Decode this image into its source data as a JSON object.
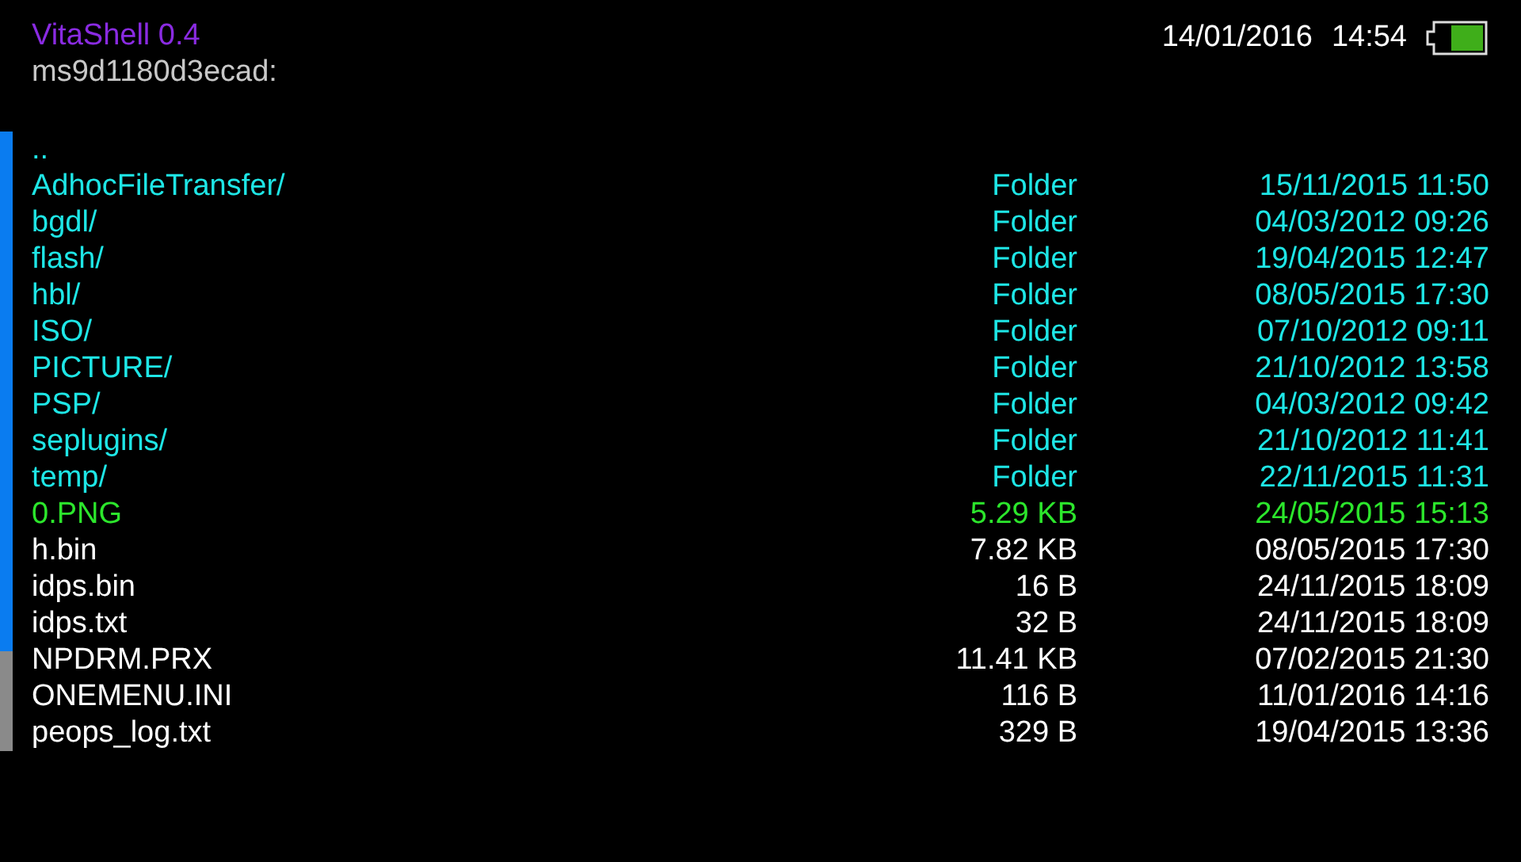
{
  "header": {
    "title": "VitaShell 0.4",
    "path": "ms9d1180d3ecad:",
    "date": "14/01/2016",
    "time": "14:54"
  },
  "files": [
    {
      "kind": "parent",
      "name": ".."
    },
    {
      "kind": "folder",
      "name": "AdhocFileTransfer/",
      "size": "Folder",
      "modified": "15/11/2015 11:50"
    },
    {
      "kind": "folder",
      "name": "bgdl/",
      "size": "Folder",
      "modified": "04/03/2012 09:26"
    },
    {
      "kind": "folder",
      "name": "flash/",
      "size": "Folder",
      "modified": "19/04/2015 12:47"
    },
    {
      "kind": "folder",
      "name": "hbl/",
      "size": "Folder",
      "modified": "08/05/2015 17:30"
    },
    {
      "kind": "folder",
      "name": "ISO/",
      "size": "Folder",
      "modified": "07/10/2012 09:11"
    },
    {
      "kind": "folder",
      "name": "PICTURE/",
      "size": "Folder",
      "modified": "21/10/2012 13:58"
    },
    {
      "kind": "folder",
      "name": "PSP/",
      "size": "Folder",
      "modified": "04/03/2012 09:42"
    },
    {
      "kind": "folder",
      "name": "seplugins/",
      "size": "Folder",
      "modified": "21/10/2012 11:41"
    },
    {
      "kind": "folder",
      "name": "temp/",
      "size": "Folder",
      "modified": "22/11/2015 11:31"
    },
    {
      "kind": "image",
      "name": "0.PNG",
      "size": "5.29 KB",
      "modified": "24/05/2015 15:13"
    },
    {
      "kind": "file",
      "name": "h.bin",
      "size": "7.82 KB",
      "modified": "08/05/2015 17:30"
    },
    {
      "kind": "file",
      "name": "idps.bin",
      "size": "16 B",
      "modified": "24/11/2015 18:09"
    },
    {
      "kind": "file",
      "name": "idps.txt",
      "size": "32 B",
      "modified": "24/11/2015 18:09"
    },
    {
      "kind": "file",
      "name": "NPDRM.PRX",
      "size": "11.41 KB",
      "modified": "07/02/2015 21:30"
    },
    {
      "kind": "file",
      "name": "ONEMENU.INI",
      "size": "116 B",
      "modified": "11/01/2016 14:16"
    },
    {
      "kind": "file",
      "name": "peops_log.txt",
      "size": "329 B",
      "modified": "19/04/2015 13:36"
    }
  ]
}
